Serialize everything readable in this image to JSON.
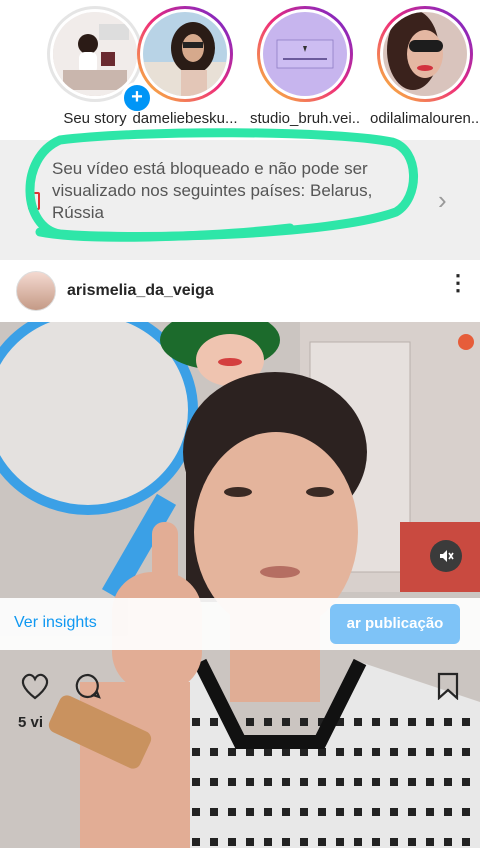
{
  "stories": [
    {
      "label": "Seu story",
      "has_plus": true
    },
    {
      "label": "dameliebesku..."
    },
    {
      "label": "studio_bruh.vei..."
    },
    {
      "label": "odilalimalouren..."
    }
  ],
  "notice": {
    "text": "Seu vídeo está bloqueado e não pode ser visualizado nos seguintes países: Belarus, Rússia",
    "chevron": "›"
  },
  "post": {
    "username": "arismelia_da_veiga",
    "menu_icon": "⋮"
  },
  "actions": {
    "insights_label": "Ver insights",
    "boost_label": "ar publicação",
    "views_label": "5 vi"
  },
  "colors": {
    "highlight": "#2ee6a8",
    "link": "#0095f6"
  }
}
